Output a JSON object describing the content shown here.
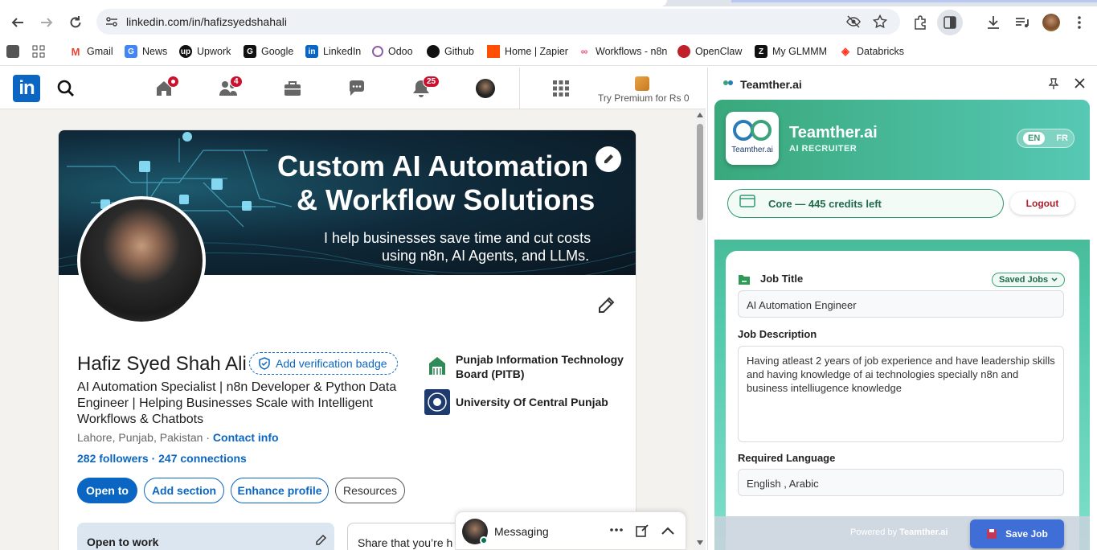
{
  "browser": {
    "url": "linkedin.com/in/hafizsyedshahali",
    "bookmarks": [
      {
        "label": "Gmail",
        "icon": "gmail-icon",
        "color": "#ea4335"
      },
      {
        "label": "News",
        "icon": "news-icon",
        "color": "#4285f4"
      },
      {
        "label": "Upwork",
        "icon": "upwork-icon",
        "color": "#111111"
      },
      {
        "label": "Google",
        "icon": "google-icon",
        "color": "#111111"
      },
      {
        "label": "LinkedIn",
        "icon": "linkedin-icon",
        "color": "#0a66c2"
      },
      {
        "label": "Odoo",
        "icon": "odoo-icon",
        "color": "#8f5da6"
      },
      {
        "label": "Github",
        "icon": "github-icon",
        "color": "#111111"
      },
      {
        "label": "Home | Zapier",
        "icon": "zapier-icon",
        "color": "#ff4f00"
      },
      {
        "label": "Workflows - n8n",
        "icon": "n8n-icon",
        "color": "#ea4b71"
      },
      {
        "label": "OpenClaw",
        "icon": "openclaw-icon",
        "color": "#c0202c"
      },
      {
        "label": "My GLMMM",
        "icon": "glm-icon",
        "color": "#111111"
      },
      {
        "label": "Databricks",
        "icon": "databricks-icon",
        "color": "#ff3621"
      }
    ]
  },
  "linkedin": {
    "nav": {
      "home_badge": "",
      "network_badge": "4",
      "notifications_badge": "25",
      "premium": "Try Premium for Rs 0"
    },
    "banner": {
      "line1": "Custom AI Automation",
      "line2": "& Workflow Solutions",
      "line3": "I help businesses save time and cut costs",
      "line4": "using n8n, AI Agents, and LLMs."
    },
    "profile": {
      "name": "Hafiz Syed Shah Ali",
      "verify": "Add verification badge",
      "headline": "AI Automation Specialist | n8n Developer & Python Data Engineer | Helping Businesses Scale with Intelligent Workflows & Chatbots",
      "location": "Lahore, Punjab, Pakistan",
      "contact": "Contact info",
      "followers": "282 followers · 247 connections",
      "org1": "Punjab Information Technology Board (PITB)",
      "org2": "University Of Central Punjab"
    },
    "buttons": {
      "open_to": "Open to",
      "add_section": "Add section",
      "enhance": "Enhance profile",
      "resources": "Resources"
    },
    "open_to_work": "Open to work",
    "share": "Share that you’re h",
    "messaging": "Messaging"
  },
  "panel": {
    "title": "Teamther.ai",
    "brand": "Teamther.ai",
    "brand_sub": "AI RECRUITER",
    "logo_text": "Teamther.ai",
    "lang_en": "EN",
    "lang_fr": "FR",
    "credits": "Core — 445 credits left",
    "logout": "Logout",
    "job_title_label": "Job Title",
    "saved_jobs": "Saved Jobs",
    "job_title_value": "AI Automation Engineer",
    "job_desc_label": "Job Description",
    "job_desc_value": "Having atleast 2 years of job experience  and have leadership skills and having knowledge of ai technologies specially n8n and business intelliugence knowledge",
    "lang_label": "Required Language",
    "lang_value": "English , Arabic",
    "powered": "Powered by",
    "powered_brand": "Teamther.ai",
    "save_job": "Save Job"
  }
}
